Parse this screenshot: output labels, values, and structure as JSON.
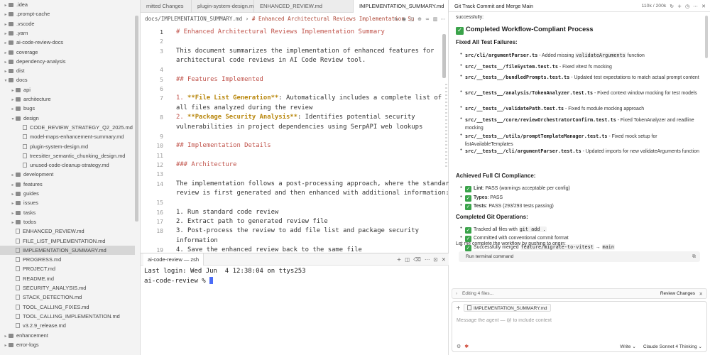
{
  "sidebar": {
    "items": [
      {
        "label": ".idea",
        "type": "folder",
        "depth": 0
      },
      {
        "label": ".prompt-cache",
        "type": "folder",
        "depth": 0
      },
      {
        "label": ".vscode",
        "type": "folder",
        "depth": 0
      },
      {
        "label": ".yarn",
        "type": "folder",
        "depth": 0
      },
      {
        "label": "ai-code-review-docs",
        "type": "folder",
        "depth": 0
      },
      {
        "label": "coverage",
        "type": "folder",
        "depth": 0
      },
      {
        "label": "dependency-analysis",
        "type": "folder",
        "depth": 0
      },
      {
        "label": "dist",
        "type": "folder",
        "depth": 0
      },
      {
        "label": "docs",
        "type": "folder",
        "depth": 0,
        "open": true
      },
      {
        "label": "api",
        "type": "folder",
        "depth": 1
      },
      {
        "label": "architecture",
        "type": "folder",
        "depth": 1
      },
      {
        "label": "bugs",
        "type": "folder",
        "depth": 1
      },
      {
        "label": "design",
        "type": "folder",
        "depth": 1,
        "open": true
      },
      {
        "label": "CODE_REVIEW_STRATEGY_Q2_2025.md",
        "type": "file",
        "depth": 2
      },
      {
        "label": "model-maps-enhancement-summary.md",
        "type": "file",
        "depth": 2
      },
      {
        "label": "plugin-system-design.md",
        "type": "file",
        "depth": 2
      },
      {
        "label": "treesitter_semantic_chunking_design.md",
        "type": "file",
        "depth": 2
      },
      {
        "label": "unused-code-cleanup-strategy.md",
        "type": "file",
        "depth": 2
      },
      {
        "label": "development",
        "type": "folder",
        "depth": 1
      },
      {
        "label": "features",
        "type": "folder",
        "depth": 1
      },
      {
        "label": "guides",
        "type": "folder",
        "depth": 1
      },
      {
        "label": "issues",
        "type": "folder",
        "depth": 1
      },
      {
        "label": "tasks",
        "type": "folder",
        "depth": 1
      },
      {
        "label": "todos",
        "type": "folder",
        "depth": 1
      },
      {
        "label": "ENHANCED_REVIEW.md",
        "type": "file",
        "depth": 1
      },
      {
        "label": "FILE_LIST_IMPLEMENTATION.md",
        "type": "file",
        "depth": 1
      },
      {
        "label": "IMPLEMENTATION_SUMMARY.md",
        "type": "file",
        "depth": 1,
        "selected": true
      },
      {
        "label": "PROGRESS.md",
        "type": "file",
        "depth": 1
      },
      {
        "label": "PROJECT.md",
        "type": "file",
        "depth": 1
      },
      {
        "label": "README.md",
        "type": "file",
        "depth": 1
      },
      {
        "label": "SECURITY_ANALYSIS.md",
        "type": "file",
        "depth": 1
      },
      {
        "label": "STACK_DETECTION.md",
        "type": "file",
        "depth": 1
      },
      {
        "label": "TOOL_CALLING_FIXES.md",
        "type": "file",
        "depth": 1
      },
      {
        "label": "TOOL_CALLING_IMPLEMENTATION.md",
        "type": "file",
        "depth": 1
      },
      {
        "label": "v3.2.9_release.md",
        "type": "file",
        "depth": 1
      },
      {
        "label": "enhancement",
        "type": "folder",
        "depth": 0
      },
      {
        "label": "error-logs",
        "type": "folder",
        "depth": 0
      }
    ]
  },
  "editor": {
    "tabs": [
      {
        "label": "mitted Changes",
        "active": false
      },
      {
        "label": "plugin-system-design.md",
        "active": false
      },
      {
        "label": "ENHANCED_REVIEW.md",
        "active": false
      },
      {
        "label": "IMPLEMENTATION_SUMMARY.md",
        "active": true
      }
    ],
    "breadcrumb": {
      "path": "docs/IMPLEMENTATION_SUMMARY.md",
      "separator": "›",
      "current": "# Enhanced Architectural Reviews Implementation Su"
    },
    "lines": [
      {
        "n": "1",
        "parts": [
          {
            "t": "# Enhanced Architectural Reviews Implementation Summary",
            "c": "hd"
          }
        ],
        "current": true
      },
      {
        "n": "2",
        "parts": []
      },
      {
        "n": "3",
        "parts": [
          {
            "t": "This document summarizes the implementation of enhanced features for",
            "c": "tx"
          }
        ]
      },
      {
        "n": "",
        "parts": [
          {
            "t": "architectural code reviews in AI Code Review tool.",
            "c": "tx"
          }
        ]
      },
      {
        "n": "4",
        "parts": []
      },
      {
        "n": "5",
        "parts": [
          {
            "t": "## Features Implemented",
            "c": "hd"
          }
        ]
      },
      {
        "n": "6",
        "parts": []
      },
      {
        "n": "7",
        "parts": [
          {
            "t": "1. ",
            "c": "num"
          },
          {
            "t": "**File List Generation**",
            "c": "bold"
          },
          {
            "t": ": Automatically includes a complete list of",
            "c": "tx"
          }
        ]
      },
      {
        "n": "",
        "parts": [
          {
            "t": "all files analyzed during the review",
            "c": "tx"
          }
        ]
      },
      {
        "n": "8",
        "parts": [
          {
            "t": "2. ",
            "c": "num"
          },
          {
            "t": "**Package Security Analysis**",
            "c": "bold"
          },
          {
            "t": ": Identifies potential security",
            "c": "tx"
          }
        ]
      },
      {
        "n": "",
        "parts": [
          {
            "t": "vulnerabilities in project dependencies using SerpAPI web lookups",
            "c": "tx"
          }
        ]
      },
      {
        "n": "9",
        "parts": []
      },
      {
        "n": "10",
        "parts": [
          {
            "t": "## Implementation Details",
            "c": "hd"
          }
        ]
      },
      {
        "n": "11",
        "parts": []
      },
      {
        "n": "12",
        "parts": [
          {
            "t": "### Architecture",
            "c": "hd"
          }
        ]
      },
      {
        "n": "13",
        "parts": []
      },
      {
        "n": "14",
        "parts": [
          {
            "t": "The implementation follows a post-processing approach, where the standard",
            "c": "tx"
          }
        ]
      },
      {
        "n": "",
        "parts": [
          {
            "t": "review is first generated and then enhanced with additional information:",
            "c": "tx"
          }
        ]
      },
      {
        "n": "15",
        "parts": []
      },
      {
        "n": "16",
        "parts": [
          {
            "t": "1. Run standard code review",
            "c": "tx"
          }
        ]
      },
      {
        "n": "17",
        "parts": [
          {
            "t": "2. Extract path to generated review file",
            "c": "tx"
          }
        ]
      },
      {
        "n": "18",
        "parts": [
          {
            "t": "3. Post-process the review to add file list and package security",
            "c": "tx"
          }
        ]
      },
      {
        "n": "",
        "parts": [
          {
            "t": "information",
            "c": "tx"
          }
        ]
      },
      {
        "n": "19",
        "parts": [
          {
            "t": "4. Save the enhanced review back to the same file",
            "c": "tx"
          }
        ]
      }
    ]
  },
  "terminal": {
    "tab_label": "ai-code-review — zsh",
    "login_line": "Last login: Wed Jun  4 12:38:04 on ttys253",
    "prompt": "ai-code-review % "
  },
  "chat": {
    "title": "Git Track Commit and Merge Main",
    "usage": "110k / 200k",
    "partial_top": "successfully:",
    "completed_heading": "Completed Workflow-Compliant Process",
    "fixed_heading": "Fixed All Test Failures:",
    "fixes": [
      {
        "path": "src/cli/argumentParser.ts",
        "pre": " - Added missing ",
        "code": "validateArguments",
        "post": " function"
      },
      {
        "path": "src/__tests__/fileSystem.test.ts",
        "pre": " - Fixed vitest fs mocking",
        "code": "",
        "post": ""
      },
      {
        "path": "src/__tests__/bundledPrompts.test.ts",
        "pre": " - Updated test expectations to match actual prompt content",
        "code": "",
        "post": ""
      },
      {
        "path": "src/__tests__/analysis/TokenAnalyzer.test.ts",
        "pre": " - Fixed context window mocking for test models",
        "code": "",
        "post": ""
      },
      {
        "path": "src/__tests__/validatePath.test.ts",
        "pre": " - Fixed fs module mocking approach",
        "code": "",
        "post": ""
      },
      {
        "path": "src/__tests__/core/reviewOrchestratorConfirm.test.ts",
        "pre": " - Fixed TokenAnalyzer and readline mocking",
        "code": "",
        "post": ""
      },
      {
        "path": "src/__tests__/utils/promptTemplateManager.test.ts",
        "pre": " - Fixed mock setup for listAvailableTemplates",
        "code": "",
        "post": ""
      },
      {
        "path": "src/__tests__/cli/argumentParser.test.ts",
        "pre": " - Updated imports for new validateArguments function",
        "code": "",
        "post": ""
      }
    ],
    "ci_heading": "Achieved Full CI Compliance:",
    "ci_items": [
      {
        "label": "Lint",
        "rest": ": PASS (warnings acceptable per config)"
      },
      {
        "label": "Types",
        "rest": ": PASS"
      },
      {
        "label": "Tests",
        "rest": ": PASS (293/293 tests passing)"
      }
    ],
    "git_heading": "Completed Git Operations:",
    "git_items": [
      {
        "pre": "Tracked all files with ",
        "code": "git add .",
        "mid": "",
        "code2": "",
        "post": ""
      },
      {
        "pre": "Committed with conventional commit format",
        "code": "",
        "mid": "",
        "code2": "",
        "post": ""
      },
      {
        "pre": "Successfully merged ",
        "code": "feature/migrate-to-vitest",
        "mid": " → ",
        "code2": "main",
        "post": ""
      }
    ],
    "closing": "Let me complete the workflow by pushing to origin:",
    "terminal_cmd": "Run terminal command",
    "editing_label": "Editing 4 files...",
    "review_changes": "Review Changes",
    "context_chip": "IMPLEMENTATION_SUMMARY.md",
    "composer_placeholder": "Message the agent — @ to include context",
    "mode": "Write",
    "model": "Claude Sonnet 4 Thinking"
  }
}
